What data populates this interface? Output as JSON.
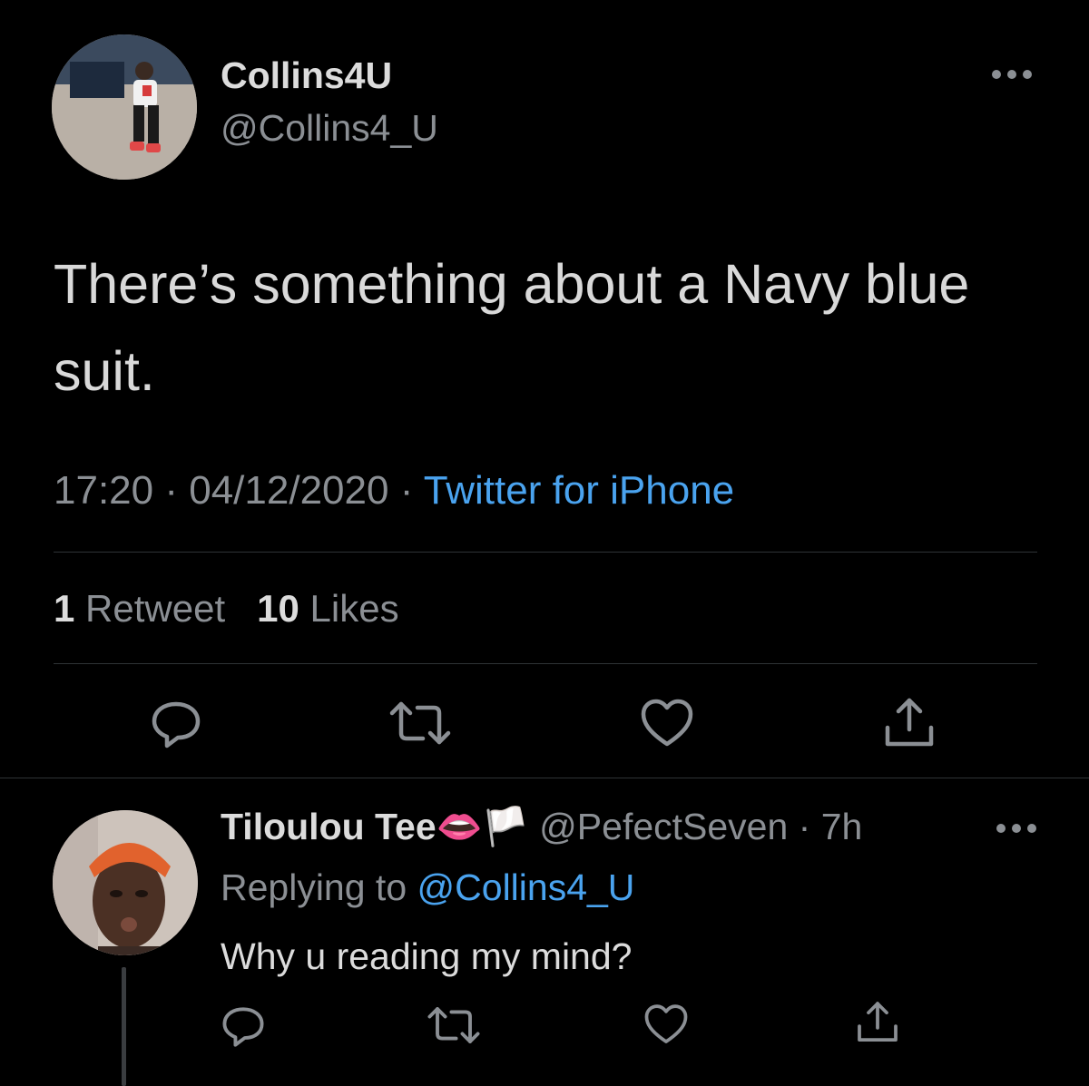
{
  "tweet": {
    "author": {
      "display_name": "Collins4U",
      "handle": "@Collins4_U"
    },
    "text": "There’s something about a Navy blue suit.",
    "time": "17:20",
    "date": "04/12/2020",
    "source": "Twitter for iPhone",
    "stats": {
      "retweets_count": "1",
      "retweets_label": "Retweet",
      "likes_count": "10",
      "likes_label": "Likes"
    }
  },
  "reply": {
    "author": {
      "display_name": "Tiloulou Tee",
      "emoji": "👄🏳️",
      "handle": "@PefectSeven",
      "age": "7h"
    },
    "replying_prefix": "Replying to",
    "replying_to": "@Collins4_U",
    "text": "Why u reading my mind?"
  },
  "icons": {
    "more": "more-horizontal-icon",
    "reply": "reply-bubble-icon",
    "retweet": "retweet-icon",
    "like": "heart-icon",
    "share": "share-icon"
  },
  "colors": {
    "background": "#000000",
    "text": "#d9d9d9",
    "muted": "#8b8f94",
    "link": "#4aa3ef",
    "divider": "#2f3336"
  }
}
